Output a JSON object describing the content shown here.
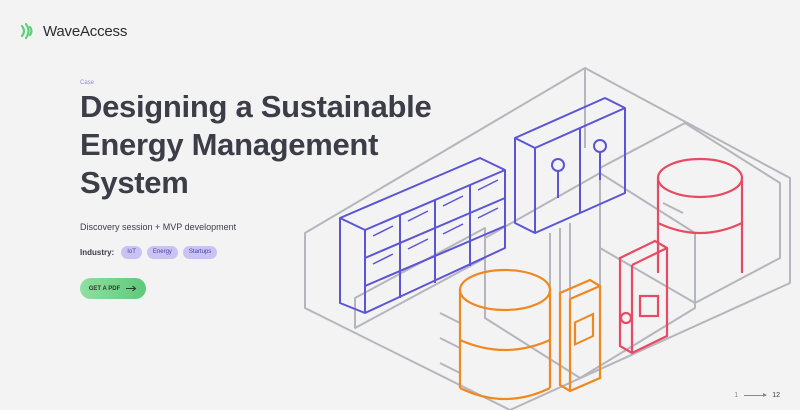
{
  "brand": {
    "name": "WaveAccess",
    "color": "#5ecf78"
  },
  "hero": {
    "case_label": "Case",
    "title": "Designing a Sustainable Energy Management System",
    "subtitle": "Discovery session + MVP development",
    "industry_label": "Industry:",
    "tags": [
      "IoT",
      "Energy",
      "Startups"
    ],
    "cta_label": "GET A PDF"
  },
  "pager": {
    "current": "1",
    "total": "12"
  },
  "colors": {
    "accent_green": "#5fc97a",
    "tag_bg": "#c9c3f3",
    "server_blue": "#5b55d6",
    "tank_orange": "#f0871f",
    "tank_red": "#e84a63",
    "wall_gray": "#b5b5bd"
  },
  "icons": {
    "logo": "wave-signal-icon",
    "cta": "arrow-right-icon",
    "pager": "arrow-right-icon"
  }
}
